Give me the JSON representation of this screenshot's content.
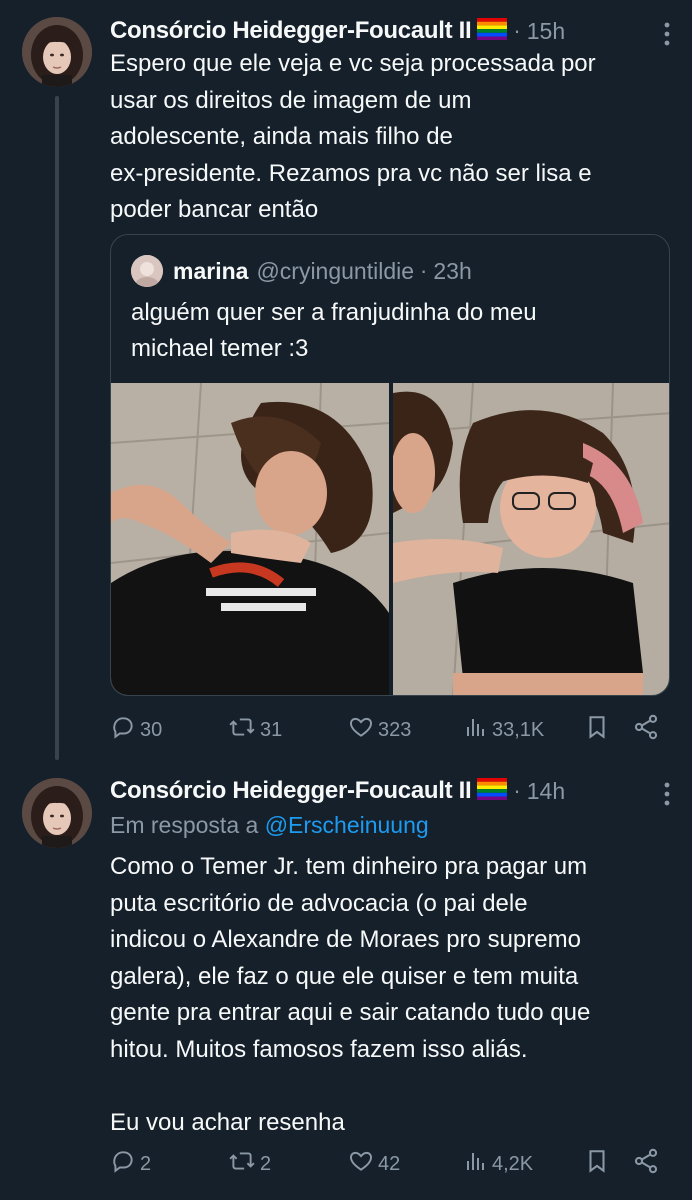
{
  "tweets": [
    {
      "author_name": "Consórcio Heidegger-Foucault II",
      "time": "15h",
      "text": "Espero que ele veja e vc seja processada por\nusar os direitos de imagem de um\nadolescente, ainda mais filho de\nex-presidente. Rezamos pra vc não ser lisa e\npoder bancar então",
      "quote": {
        "author_name": "marina",
        "handle": "@cryinguntildie",
        "time": "23h",
        "text": "alguém quer ser a franjudinha do meu\nmichael temer :3"
      },
      "stats": {
        "replies": "30",
        "retweets": "31",
        "likes": "323",
        "views": "33,1K"
      }
    },
    {
      "author_name": "Consórcio Heidegger-Foucault II",
      "time": "14h",
      "reply_prefix": "Em resposta a",
      "reply_handle": "@Erscheinuung",
      "text": "Como o Temer Jr. tem dinheiro pra pagar um\nputa escritório de advocacia (o pai dele\nindicou o Alexandre de Moraes pro supremo\ngalera), ele faz o que ele quiser e tem muita\ngente pra entrar aqui e sair catando tudo que\nhitou. Muitos famosos fazem isso aliás.\n\nEu vou achar resenha",
      "stats": {
        "replies": "2",
        "retweets": "2",
        "likes": "42",
        "views": "4,2K"
      }
    }
  ],
  "icons": {
    "flag": "rainbow-flag-icon",
    "more": "more-dots-icon",
    "reply": "reply-icon",
    "retweet": "retweet-icon",
    "like": "heart-icon",
    "views": "views-icon",
    "bookmark": "bookmark-icon",
    "share": "share-icon"
  },
  "colors": {
    "background": "#15202b",
    "text": "#f7f9f9",
    "secondary": "#8b98a5",
    "link": "#1d9bf0",
    "border": "#38444d"
  }
}
